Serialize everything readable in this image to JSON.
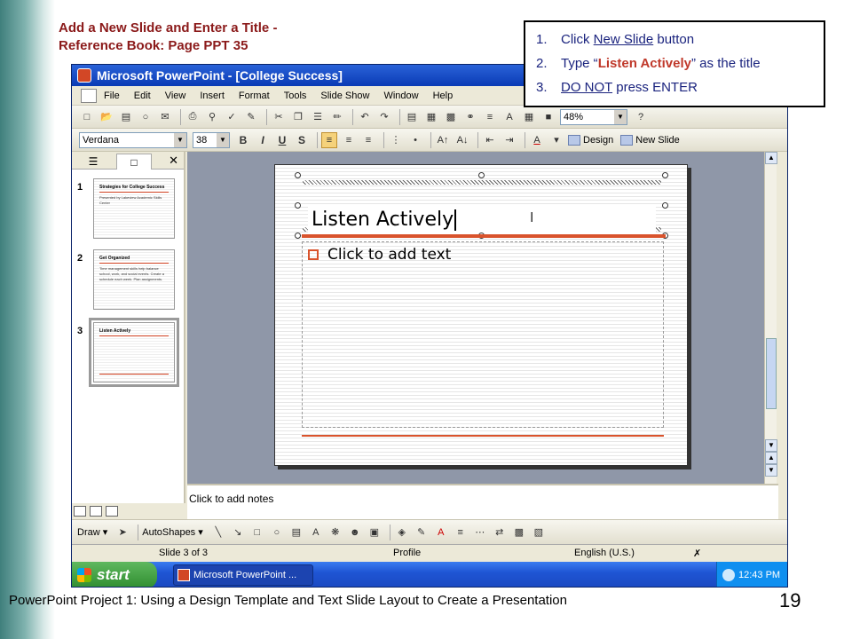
{
  "slide_heading": {
    "line1": "Add a New Slide and Enter a Title -",
    "line2": "Reference Book:  Page PPT 35"
  },
  "steps": [
    {
      "num": "1.",
      "pre": "Click ",
      "emph": "New Slide",
      "post": " button"
    },
    {
      "num": "2.",
      "pre": "Type “",
      "emph": "Listen Actively",
      "post": "” as the title"
    },
    {
      "num": "3.",
      "pre": "",
      "emph": "DO NOT",
      "post": " press ENTER"
    }
  ],
  "window": {
    "title": "Microsoft PowerPoint - [College Success]",
    "menu": [
      "File",
      "Edit",
      "View",
      "Insert",
      "Format",
      "Tools",
      "Slide Show",
      "Window",
      "Help"
    ],
    "zoom": "48%",
    "font_name": "Verdana",
    "font_size": "38",
    "design_label": "Design",
    "new_slide_label": "New Slide"
  },
  "thumbnails": [
    {
      "num": "1",
      "title": "Strategies for College Success",
      "body": "Presented by Lakeview Academic Skills Center"
    },
    {
      "num": "2",
      "title": "Get Organized",
      "body": "Time management skills help balance school, work, and social events. Create a schedule each week. Plan assignments."
    },
    {
      "num": "3",
      "title": "Listen Actively",
      "body": ""
    }
  ],
  "slide": {
    "title_text": "Listen Actively",
    "body_placeholder": "Click to add text",
    "notes_placeholder": "Click to add notes"
  },
  "drawing": {
    "draw_label": "Draw",
    "autoshapes_label": "AutoShapes"
  },
  "status": {
    "slide_info": "Slide 3 of 3",
    "design": "Profile",
    "language": "English (U.S.)"
  },
  "taskbar": {
    "start": "start",
    "task": "Microsoft PowerPoint ...",
    "clock": "12:43 PM"
  },
  "footer": {
    "caption": "PowerPoint Project 1: Using a Design Template and Text Slide Layout to Create a Presentation",
    "page_number": "19"
  },
  "colors": {
    "heading": "#8b1a1a",
    "steps_text": "#1a237e",
    "accent": "#d9532c",
    "teal": "#3f7f7c"
  }
}
